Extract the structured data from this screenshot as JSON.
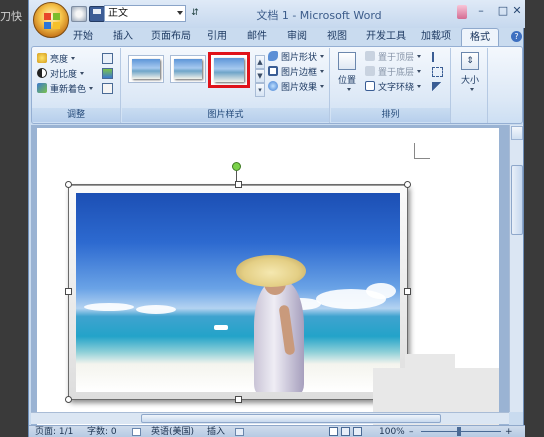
{
  "window": {
    "title": "文档 1 - Microsoft Word",
    "left_cut_text": "刀快",
    "min": "–",
    "max": "□",
    "close": "✕"
  },
  "quick_access": {
    "style_value": "正文",
    "more": "⇵"
  },
  "tabs": [
    {
      "label": "开始"
    },
    {
      "label": "插入"
    },
    {
      "label": "页面布局"
    },
    {
      "label": "引用"
    },
    {
      "label": "邮件"
    },
    {
      "label": "审阅"
    },
    {
      "label": "视图"
    },
    {
      "label": "开发工具"
    },
    {
      "label": "加载项"
    },
    {
      "label": "格式",
      "active": true
    }
  ],
  "help_glyph": "?",
  "ribbon": {
    "adjust": {
      "label": "调整",
      "brightness": "亮度",
      "contrast": "对比度",
      "recolor": "重新着色"
    },
    "picture_styles": {
      "label": "图片样式",
      "shape": "图片形状",
      "border": "图片边框",
      "effects": "图片效果",
      "selected_thumb": 3
    },
    "arrange": {
      "label": "排列",
      "position": "位置",
      "bring_front": "置于顶层",
      "send_back": "置于底层",
      "text_wrap": "文字环绕"
    },
    "size": {
      "label": "大小"
    }
  },
  "status": {
    "page": "页面: 1/1",
    "words": "字数: 0",
    "language": "英语(美国)",
    "insert": "插入",
    "zoom": "100%",
    "minus": "–",
    "plus": "+"
  },
  "colors": {
    "selected_highlight": "#e0121a",
    "active_tab": "#eef4fb",
    "ribbon_bg": "#dce8f6"
  }
}
